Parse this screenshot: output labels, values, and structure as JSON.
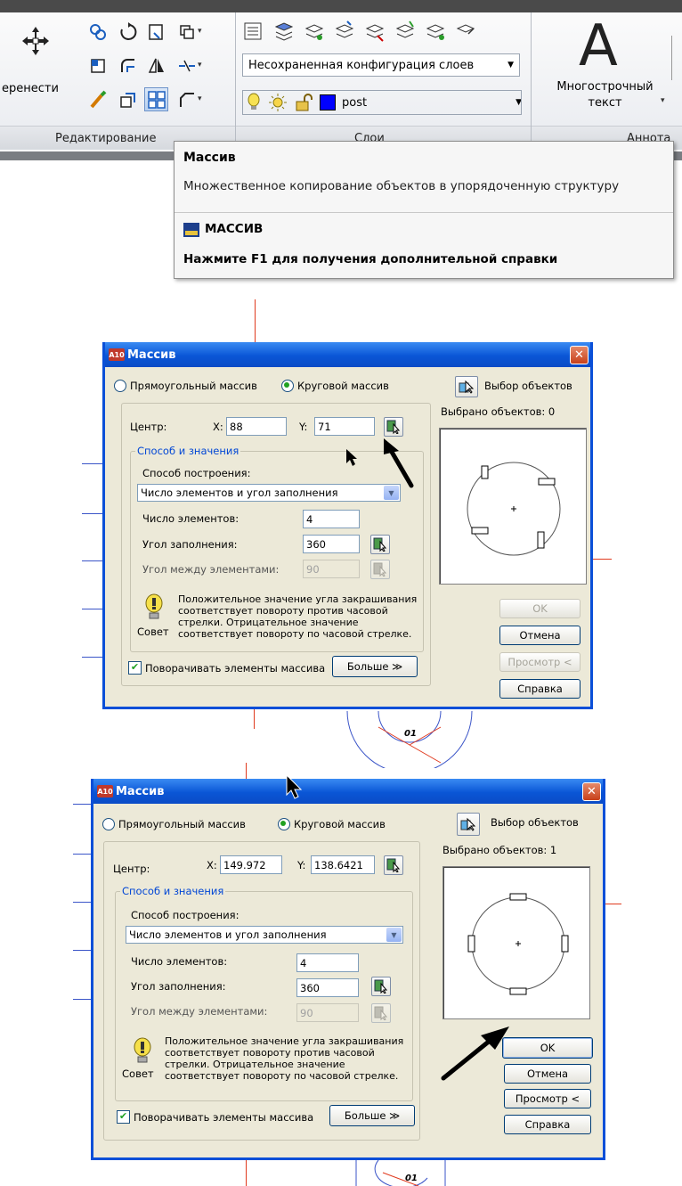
{
  "ribbon": {
    "move_label": "еренести",
    "layer_config": "Несохраненная конфигурация слоев",
    "layer_name": "post",
    "layer_color": "#0000ff",
    "text_label_1": "Многострочный",
    "text_label_2": "текст",
    "panel_edit": "Редактирование",
    "panel_layers": "Слои",
    "panel_annot": "Аннота"
  },
  "tooltip": {
    "title": "Массив",
    "description": "Множественное копирование объектов в упорядоченную структуру",
    "command": "МАССИВ",
    "help": "Нажмите F1 для получения дополнительной справки"
  },
  "dialogs": [
    {
      "title": "Массив",
      "app_icon": "A10",
      "radio_rect": "Прямоугольный массив",
      "radio_polar": "Круговой массив",
      "select_objects": "Выбор объектов",
      "selected_count": "Выбрано объектов: 0",
      "center_label": "Центр:",
      "x_label": "X:",
      "x_value": "88",
      "y_label": "Y:",
      "y_value": "71",
      "group_title": "Способ и значения",
      "method_label": "Способ построения:",
      "method_value": "Число элементов и угол заполнения",
      "count_label": "Число элементов:",
      "count_value": "4",
      "fill_label": "Угол заполнения:",
      "fill_value": "360",
      "between_label": "Угол между элементами:",
      "between_value": "90",
      "tip_text_1": "Положительное значение угла закрашивания",
      "tip_text_2": "соответствует повороту против часовой",
      "tip_text_3": "стрелки. Отрицательное значение",
      "tip_text_4": "соответствует повороту по часовой стрелке.",
      "tip_label": "Совет",
      "rotate_label": "Поворачивать элементы массива",
      "more_label": "Больше ≫",
      "ok_label": "OK",
      "cancel_label": "Отмена",
      "preview_label": "Просмотр <",
      "help_label": "Справка",
      "ok_enabled": false,
      "preview_enabled": false
    },
    {
      "title": "Массив",
      "app_icon": "A10",
      "radio_rect": "Прямоугольный массив",
      "radio_polar": "Круговой массив",
      "select_objects": "Выбор объектов",
      "selected_count": "Выбрано объектов: 1",
      "center_label": "Центр:",
      "x_label": "X:",
      "x_value": "149.972",
      "y_label": "Y:",
      "y_value": "138.6421",
      "group_title": "Способ и значения",
      "method_label": "Способ построения:",
      "method_value": "Число элементов и угол заполнения",
      "count_label": "Число элементов:",
      "count_value": "4",
      "fill_label": "Угол заполнения:",
      "fill_value": "360",
      "between_label": "Угол между элементами:",
      "between_value": "90",
      "tip_text_1": "Положительное значение угла закрашивания",
      "tip_text_2": "соответствует повороту против часовой",
      "tip_text_3": "стрелки. Отрицательное значение",
      "tip_text_4": "соответствует повороту по часовой стрелке.",
      "tip_label": "Совет",
      "rotate_label": "Поворачивать элементы массива",
      "more_label": "Больше ≫",
      "ok_label": "OK",
      "cancel_label": "Отмена",
      "preview_label": "Просмотр <",
      "help_label": "Справка",
      "ok_enabled": true,
      "preview_enabled": true
    }
  ],
  "drawing": {
    "tag_1": "01",
    "tag_2": "01"
  }
}
